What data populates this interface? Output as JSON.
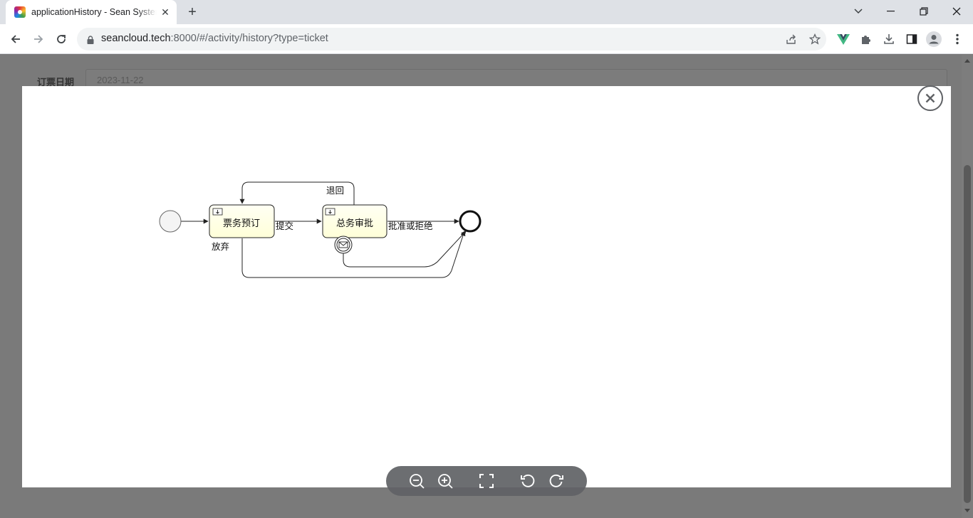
{
  "browser": {
    "tab_title": "applicationHistory - Sean System",
    "url_host": "seancloud.tech",
    "url_rest": ":8000/#/activity/history?type=ticket"
  },
  "page": {
    "field_label": "订票日期",
    "field_value": "2023-11-22"
  },
  "diagram": {
    "tasks": [
      {
        "label": "票务预订"
      },
      {
        "label": "总务审批"
      }
    ],
    "flows": {
      "submit": "提交",
      "return": "退回",
      "approve_or_reject": "批准或拒绝",
      "abandon": "放弃"
    }
  },
  "icons": {
    "close": "close-circle-icon",
    "zoom_out": "zoom-out-icon",
    "zoom_in": "zoom-in-icon",
    "fullscreen": "fullscreen-icon",
    "rotate_left": "rotate-left-icon",
    "rotate_right": "rotate-right-icon"
  },
  "colors": {
    "task_fill": "#ffffe0",
    "overlay": "#777777",
    "toolbar_bg": "#606266",
    "vue_green": "#41b883"
  }
}
